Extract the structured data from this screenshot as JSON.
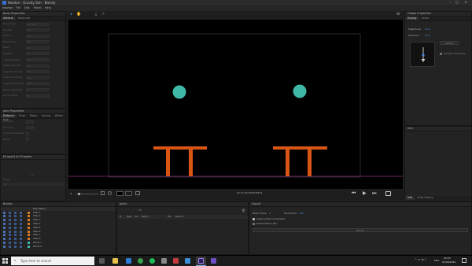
{
  "window": {
    "title": "Newton - Gravity Sim - Blendy",
    "minimize": "–",
    "maximize": "□",
    "close": "✕"
  },
  "menu": [
    "Newton",
    "File",
    "Edit",
    "Panel",
    "Help"
  ],
  "body_properties": {
    "title": "Body Properties",
    "tabs": [
      "General",
      "Advanced"
    ],
    "rows": [
      {
        "label": "Body Type",
        "value": "Dynamic"
      },
      {
        "label": "Density",
        "value": "1.0"
      },
      {
        "label": "Friction",
        "value": "0.5"
      },
      {
        "label": "Bounciness",
        "value": "0.0"
      },
      {
        "label": "Mass",
        "value": "1.0"
      },
      {
        "label": "Rotation",
        "value": "0"
      },
      {
        "label": "Initial Velocity",
        "value": "0.0"
      },
      {
        "label": "Linear Velocity",
        "value": "0.0"
      },
      {
        "label": "Angular Velocity",
        "value": "0.0"
      },
      {
        "label": "Linear Damping",
        "value": "0.0"
      },
      {
        "label": "Angular Damping",
        "value": "0.0"
      },
      {
        "label": "Motion Blending",
        "value": "0"
      },
      {
        "label": "Active Steps",
        "value": "0"
      }
    ]
  },
  "joint_properties": {
    "title": "Joint Properties",
    "tabs": [
      "Distance",
      "Pivot",
      "Piston",
      "Spring",
      "Wheel",
      "Blob"
    ],
    "rows": [
      "Stiffness",
      "Damping",
      "Collide Connected",
      "Break"
    ]
  },
  "puppets": {
    "title": "[Puppet] Art Puppets",
    "dash": "—",
    "subrows": [
      "Target",
      "Pin"
    ]
  },
  "toolbar": {
    "select": "▸",
    "hand": "✋",
    "anchor": "⤓",
    "pin": "↗",
    "grid": "⊞"
  },
  "scene": {
    "bg": "#000000",
    "bounds_color": "#3c3c3c",
    "ball_color": "#3fb8a8",
    "table_color": "#d95515",
    "ground_color": "#8a2a8a"
  },
  "controls": {
    "time": "00:12:04:0",
    "frame": "3287/4819",
    "pitch_left": "◂",
    "zoom_icon": "⊕"
  },
  "global_properties": {
    "title": "Global Properties",
    "tabs": [
      "Gravity",
      "Solver"
    ],
    "magnitude_label": "Magnitude",
    "magnitude_value": "10.0",
    "direction_label": "Direction",
    "direction_value": "90.0",
    "capture": "Capture",
    "attractor_label": "Attractor Properties"
  },
  "info": {
    "title": "Info",
    "tabs": [
      "Info",
      "Undo History"
    ]
  },
  "bodies": {
    "title": "Bodies",
    "header": "Body Name",
    "items": [
      {
        "name": "Table 1",
        "color": "#d97a22"
      },
      {
        "name": "Table 2",
        "color": "#d97a22"
      },
      {
        "name": "Table 3",
        "color": "#d97a22"
      },
      {
        "name": "Table 4",
        "color": "#d97a22"
      },
      {
        "name": "Table 5",
        "color": "#d97a22"
      },
      {
        "name": "Table 6",
        "color": "#d97a22"
      },
      {
        "name": "Table 7",
        "color": "#d97a22"
      },
      {
        "name": "Table 8",
        "color": "#d97a22"
      },
      {
        "name": "Planet 1",
        "color": "#3fb8a8"
      },
      {
        "name": "Planet 2",
        "color": "#3fb8a8"
      }
    ]
  },
  "joints": {
    "title": "Joints",
    "columns": [
      "#",
      "Type",
      "Col",
      "Body A",
      "Hld",
      "Body B"
    ]
  },
  "export": {
    "title": "Export",
    "start_label": "Start Frame",
    "start_value": "1",
    "end_label": "End Frame",
    "end_value": "150",
    "opt1": "Apply to New Composition",
    "opt2": "Enable Motion Blur",
    "render": "Render"
  },
  "taskbar": {
    "search": "Type here to search",
    "time": "09:33",
    "date": "01/06/2020",
    "lang": "ENG"
  }
}
